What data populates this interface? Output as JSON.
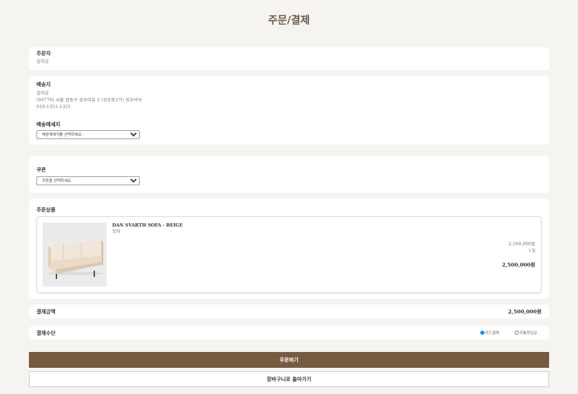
{
  "page": {
    "title": "주문/결제"
  },
  "orderer": {
    "label": "주문자",
    "name": "김허깅"
  },
  "shipping": {
    "label": "배송지",
    "name": "김허깅",
    "address": "(04776) 서울 성동구 성수이로 2 (성수동2가) 성수낙낙",
    "phone": "010-1351-1351",
    "message_label": "배송메세지",
    "message_selected": "배송메세지를 선택하세요."
  },
  "coupon": {
    "label": "쿠폰",
    "selected": "쿠폰을 선택하세요."
  },
  "products": {
    "label": "주문상품",
    "items": [
      {
        "name": "DAN SVARTH SOFA - BEIGE",
        "category": "의자",
        "unit_price": "2,500,000원",
        "quantity": "1개",
        "total": "2,500,000원"
      }
    ]
  },
  "payment_amount": {
    "label": "결제금액",
    "value": "2,500,000원"
  },
  "payment_method": {
    "label": "결제수단",
    "options": [
      {
        "label": "카드결제",
        "selected": true
      },
      {
        "label": "무통장입금",
        "selected": false
      }
    ]
  },
  "actions": {
    "order_label": "주문하기",
    "back_label": "장바구니로 돌아가기"
  },
  "colors": {
    "accent": "#765b40",
    "background": "#f5f4f1",
    "title": "#6b5a4a"
  }
}
